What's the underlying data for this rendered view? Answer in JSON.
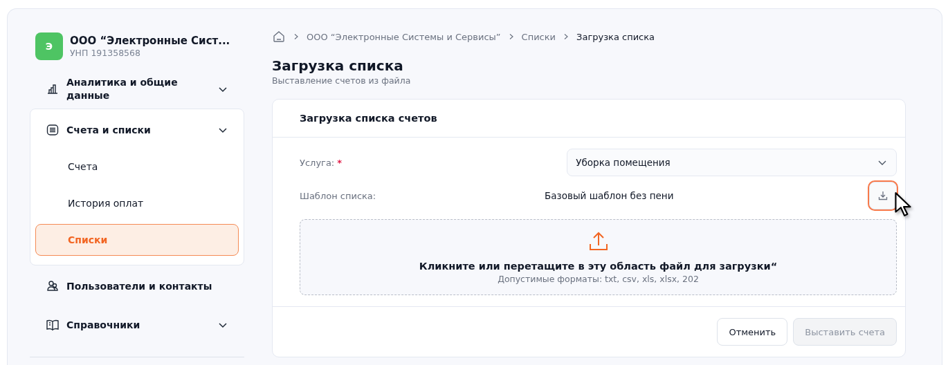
{
  "company": {
    "avatar": "Э",
    "name": "ООО “Электронные Сист...",
    "unp": "УНП 191358568"
  },
  "nav": [
    {
      "label": "Аналитика и общие данные",
      "expandable": true,
      "expanded": false
    },
    {
      "label": "Счета и списки",
      "expandable": true,
      "expanded": true,
      "children": [
        {
          "label": "Счета",
          "selected": false
        },
        {
          "label": "История оплат",
          "selected": false
        },
        {
          "label": "Списки",
          "selected": true
        }
      ]
    },
    {
      "label": "Пользователи и контакты",
      "expandable": false,
      "expanded": false
    },
    {
      "label": "Справочники",
      "expandable": true,
      "expanded": false
    }
  ],
  "breadcrumbs": [
    "ООО “Электронные Системы и Сервисы”",
    "Списки",
    "Загрузка списка"
  ],
  "page": {
    "title": "Загрузка списка",
    "subtitle": "Выставление счетов из файла"
  },
  "card": {
    "title": "Загрузка списка счетов",
    "service": {
      "label": "Услуга:",
      "required_mark": "*",
      "value": "Уборка помещения"
    },
    "template": {
      "label": "Шаблон списка:",
      "value": "Базовый шаблон без пени",
      "download_focused": true
    },
    "dropzone": {
      "text": "Кликните или перетащите в эту область файл для загрузки“",
      "hint": "Допустимые форматы: txt, csv, xls, xlsx, 202"
    },
    "buttons": [
      {
        "label": "Отменить",
        "disabled": false
      },
      {
        "label": "Выставить счета",
        "disabled": true
      }
    ]
  }
}
